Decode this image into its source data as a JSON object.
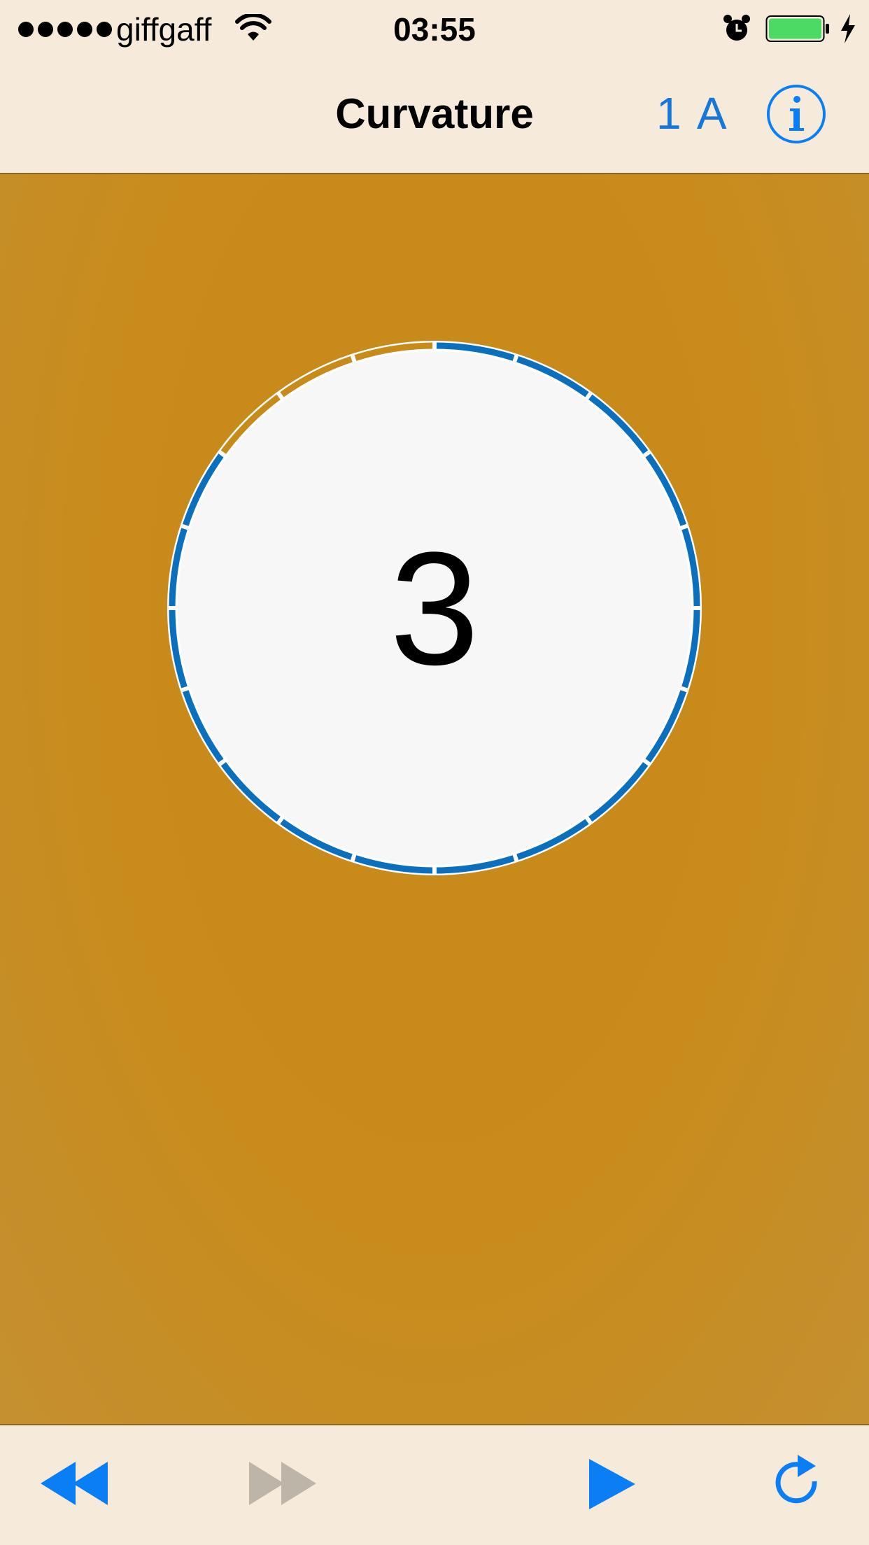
{
  "status_bar": {
    "carrier": "giffgaff",
    "time": "03:55",
    "signal_bars": 5,
    "battery_percent": 100,
    "icons": [
      "signal-dots",
      "wifi-icon",
      "alarm-icon",
      "battery-icon",
      "charging-icon"
    ]
  },
  "nav": {
    "title": "Curvature",
    "level_label": "1 A",
    "info_icon": "info-icon"
  },
  "timer": {
    "counter": "3",
    "total_segments": 20,
    "remaining_segments": 17,
    "colors": {
      "remaining": "#0a6fbd",
      "elapsed": "#c88a18",
      "face": "#f7f7f7",
      "background": "#c88a18"
    }
  },
  "toolbar": {
    "icons": [
      "rewind-icon",
      "fast-forward-icon",
      "play-icon",
      "restart-icon"
    ],
    "forward_enabled": false,
    "accent": "#0a7ff5",
    "disabled": "#bdb6a8"
  }
}
